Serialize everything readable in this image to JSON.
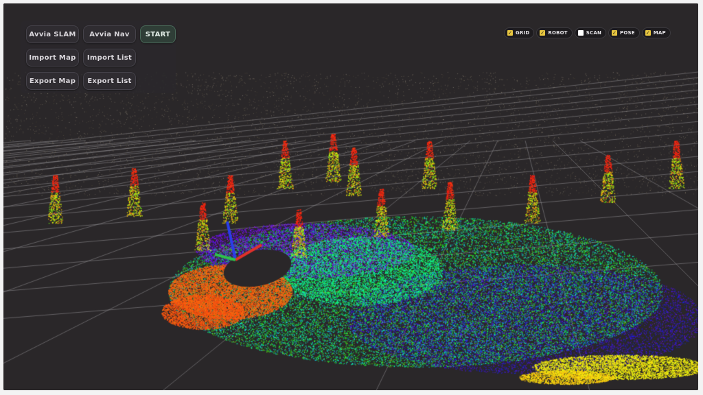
{
  "toolbar": {
    "buttons": {
      "avvia_slam": "Avvia SLAM",
      "avvia_nav": "Avvia Nav",
      "start": "START",
      "import_map": "Import Map",
      "import_list": "Import List",
      "export_map": "Export Map",
      "export_list": "Export List"
    }
  },
  "layers": [
    {
      "label": "GRID",
      "checked": true
    },
    {
      "label": "ROBOT",
      "checked": true
    },
    {
      "label": "SCAN",
      "checked": false
    },
    {
      "label": "POSE",
      "checked": true
    },
    {
      "label": "MAP",
      "checked": true
    }
  ],
  "colors": {
    "background": "#2a2729",
    "grid": "#8a888c",
    "axis_x": "#e0302a",
    "axis_y": "#2ec24a",
    "axis_z": "#2a3ee8",
    "checkbox_on": "#e8c640",
    "checkbox_off": "#ffffff",
    "start_accent": "#2f3e37"
  },
  "icons": {
    "checked": "check-mark-icon",
    "unchecked": "empty-box-icon"
  }
}
